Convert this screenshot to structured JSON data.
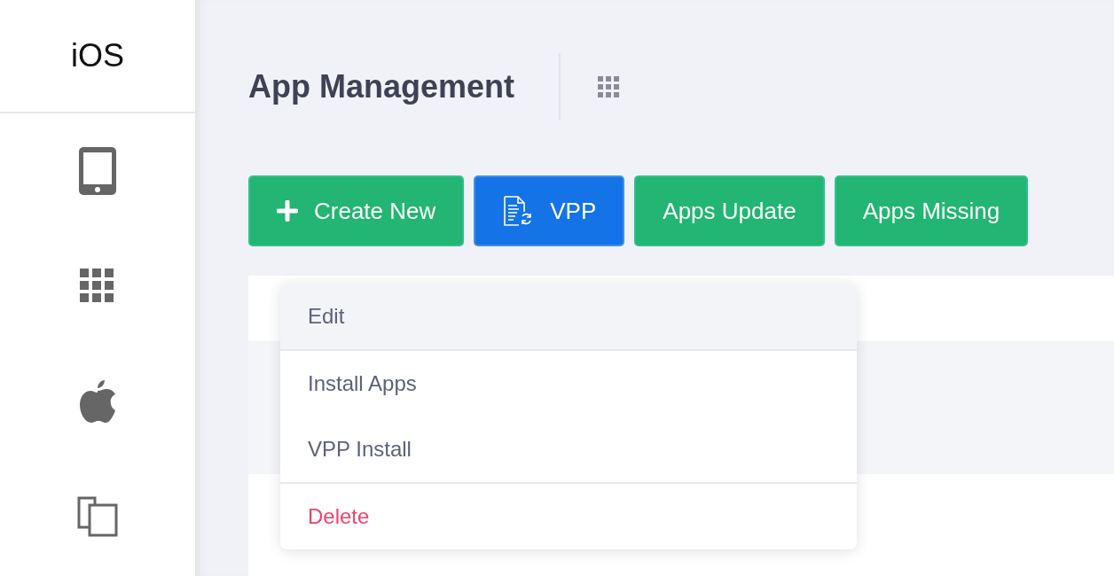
{
  "sidebar": {
    "title": "iOS",
    "items": [
      {
        "kind": "tablet",
        "selected": false
      },
      {
        "kind": "apps",
        "selected": false
      },
      {
        "kind": "apple",
        "selected": false
      },
      {
        "kind": "copy",
        "selected": false
      }
    ]
  },
  "header": {
    "title": "App Management"
  },
  "buttons": [
    {
      "label": "Create New",
      "kind": "create"
    },
    {
      "label": "VPP",
      "kind": "vpp"
    },
    {
      "label": "Apps Update",
      "kind": "plain"
    },
    {
      "label": "Apps Missing",
      "kind": "plain"
    }
  ],
  "context_menu": {
    "groups": [
      [
        {
          "label": "Edit",
          "kind": "normal",
          "selected": true
        }
      ],
      [
        {
          "label": "Install Apps",
          "kind": "normal",
          "selected": false
        },
        {
          "label": "VPP Install",
          "kind": "normal",
          "selected": false
        }
      ],
      [
        {
          "label": "Delete",
          "kind": "danger",
          "selected": false
        }
      ]
    ]
  }
}
